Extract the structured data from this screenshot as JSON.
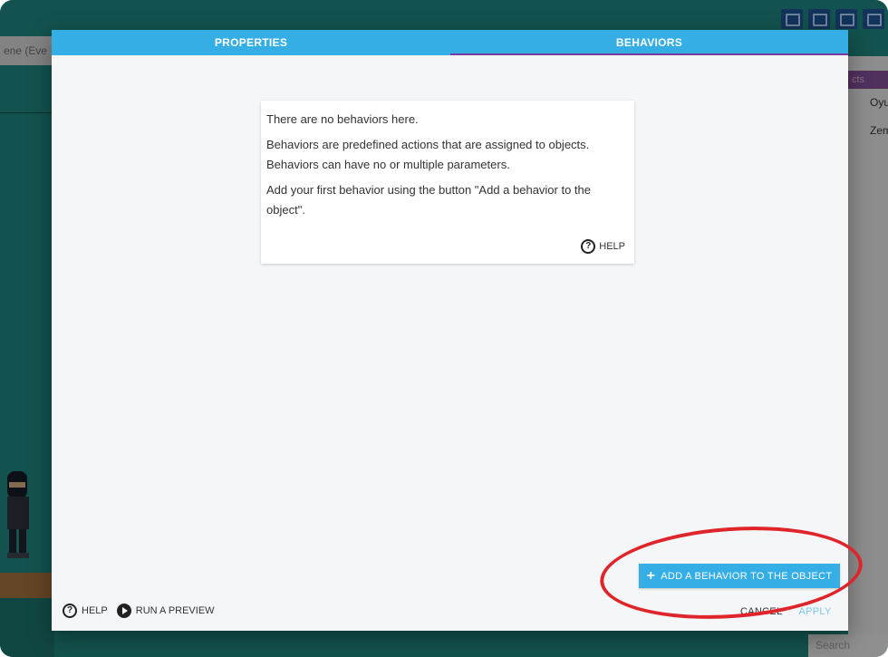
{
  "background": {
    "scene_tab_label": "ene (Eve",
    "objects_header": "cts",
    "object_items": [
      "Oyu",
      "Zem"
    ],
    "search_placeholder": "Search"
  },
  "dialog": {
    "tabs": {
      "properties": "PROPERTIES",
      "behaviors": "BEHAVIORS"
    },
    "active_tab": "BEHAVIORS",
    "empty_card": {
      "line1": "There are no behaviors here.",
      "line2": "Behaviors are predefined actions that are assigned to objects. Behaviors can have no or multiple parameters.",
      "line3": "Add your first behavior using the button \"Add a behavior to the object\".",
      "help_label": "HELP"
    },
    "add_button_label": "ADD A BEHAVIOR TO THE OBJECT",
    "footer": {
      "help_label": "HELP",
      "preview_label": "RUN A PREVIEW",
      "cancel_label": "CANCEL",
      "apply_label": "APPLY"
    }
  },
  "annotation": {
    "color": "#e0252a",
    "shape": "ellipse"
  },
  "colors": {
    "accent": "#35aee6",
    "tab_indicator": "#7c3aa0",
    "scene_bg": "#1e7f79"
  }
}
